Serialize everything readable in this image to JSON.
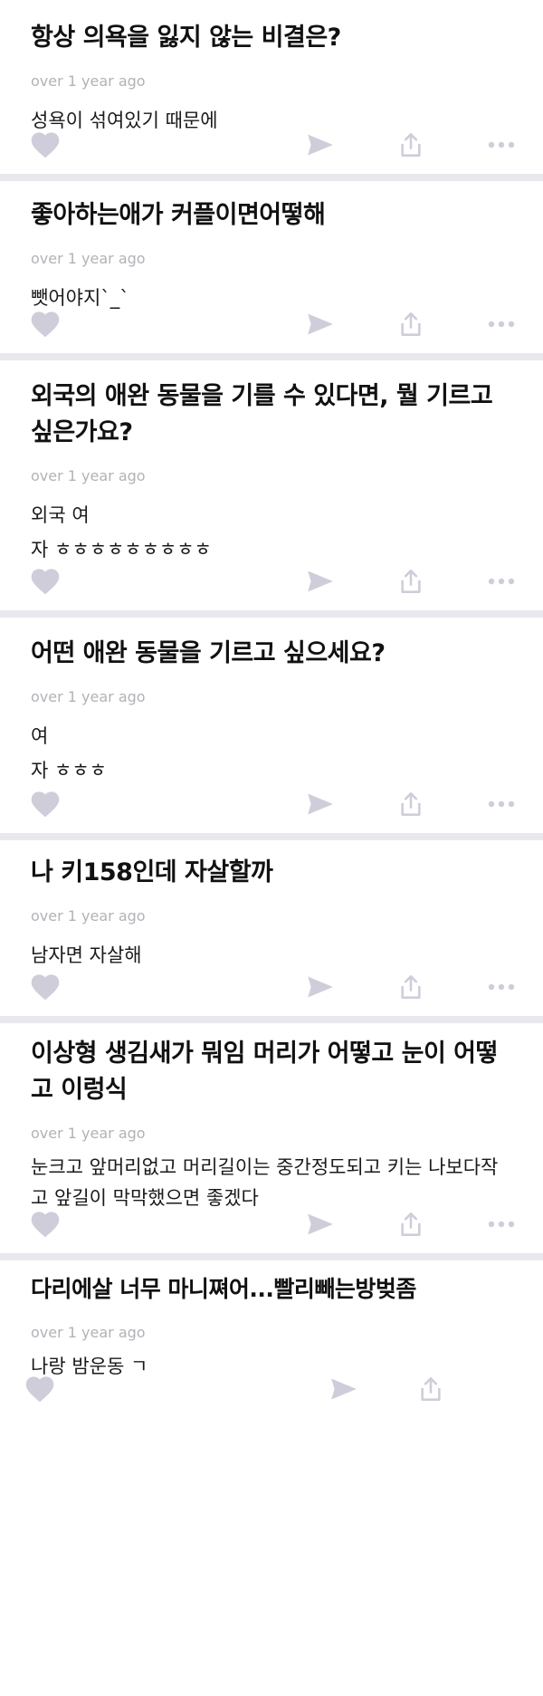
{
  "posts": [
    {
      "question": "항상 의욕을 잃지 않는 비결은?",
      "time": "over 1 year ago",
      "answer": "성욕이 섞여있기 때문에"
    },
    {
      "question": "좋아하는애가 커플이면어떻해",
      "time": "over 1 year ago",
      "answer": "뺏어야지`_`"
    },
    {
      "question": "외국의 애완 동물을 기를 수 있다면, 뭘 기르고 싶은가요?",
      "time": "over 1 year ago",
      "answer": "외국 여\n자 ㅎㅎㅎㅎㅎㅎㅎㅎㅎ"
    },
    {
      "question": "어떤 애완 동물을 기르고 싶으세요?",
      "time": "over 1 year ago",
      "answer": "여\n자 ㅎㅎㅎ"
    },
    {
      "question": "나 키158인데 자살할까",
      "time": "over 1 year ago",
      "answer": "남자면 자살해"
    },
    {
      "question": "이상형 생김새가 뭐임 머리가 어떻고 눈이 어떻고 이렁식",
      "time": "over 1 year ago",
      "answer": "눈크고 앞머리없고 머리길이는 중간정도되고 키는 나보다작고 앞길이 막막했으면 좋겠다"
    },
    {
      "question": "다리에살 너무 마니쪄어...빨리빼는방벚좀",
      "time": "over 1 year ago",
      "answer": "나랑 밤운동 ㄱ"
    }
  ],
  "icons": {
    "like": "heart-icon",
    "send": "paper-plane-icon",
    "share": "share-icon",
    "more": "more-dots-icon"
  },
  "colors": {
    "background": "#e9e8ee",
    "card": "#ffffff",
    "icon": "#cfcdd9",
    "meta_text": "#b2b2b8"
  }
}
